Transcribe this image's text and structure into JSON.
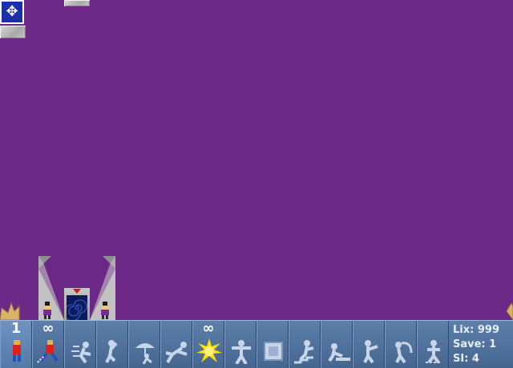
{
  "game": {
    "background_color": "#6b2886",
    "move_button_icon": "four-way-arrows-icon"
  },
  "skills": [
    {
      "name": "walker",
      "count": "1",
      "icon": "walker-lix-icon",
      "selected": true
    },
    {
      "name": "runner",
      "count": "∞",
      "icon": "runner-lix-icon"
    },
    {
      "name": "sprinter",
      "count": "",
      "icon": "sprinter-icon"
    },
    {
      "name": "climber",
      "count": "",
      "icon": "climber-icon"
    },
    {
      "name": "floater",
      "count": "",
      "icon": "umbrella-floater-icon"
    },
    {
      "name": "jumper",
      "count": "",
      "icon": "jumper-icon"
    },
    {
      "name": "exploder",
      "count": "∞",
      "icon": "explosion-icon"
    },
    {
      "name": "blocker",
      "count": "",
      "icon": "blocker-icon"
    },
    {
      "name": "cuber",
      "count": "",
      "icon": "cube-icon"
    },
    {
      "name": "builder",
      "count": "",
      "icon": "builder-icon"
    },
    {
      "name": "platformer",
      "count": "",
      "icon": "platformer-icon"
    },
    {
      "name": "basher",
      "count": "",
      "icon": "basher-icon"
    },
    {
      "name": "miner",
      "count": "",
      "icon": "miner-icon"
    },
    {
      "name": "digger",
      "count": "",
      "icon": "digger-icon"
    }
  ],
  "stats": {
    "lix": "Lix: 999",
    "save": "Save: 1",
    "si": "SI: 4"
  }
}
